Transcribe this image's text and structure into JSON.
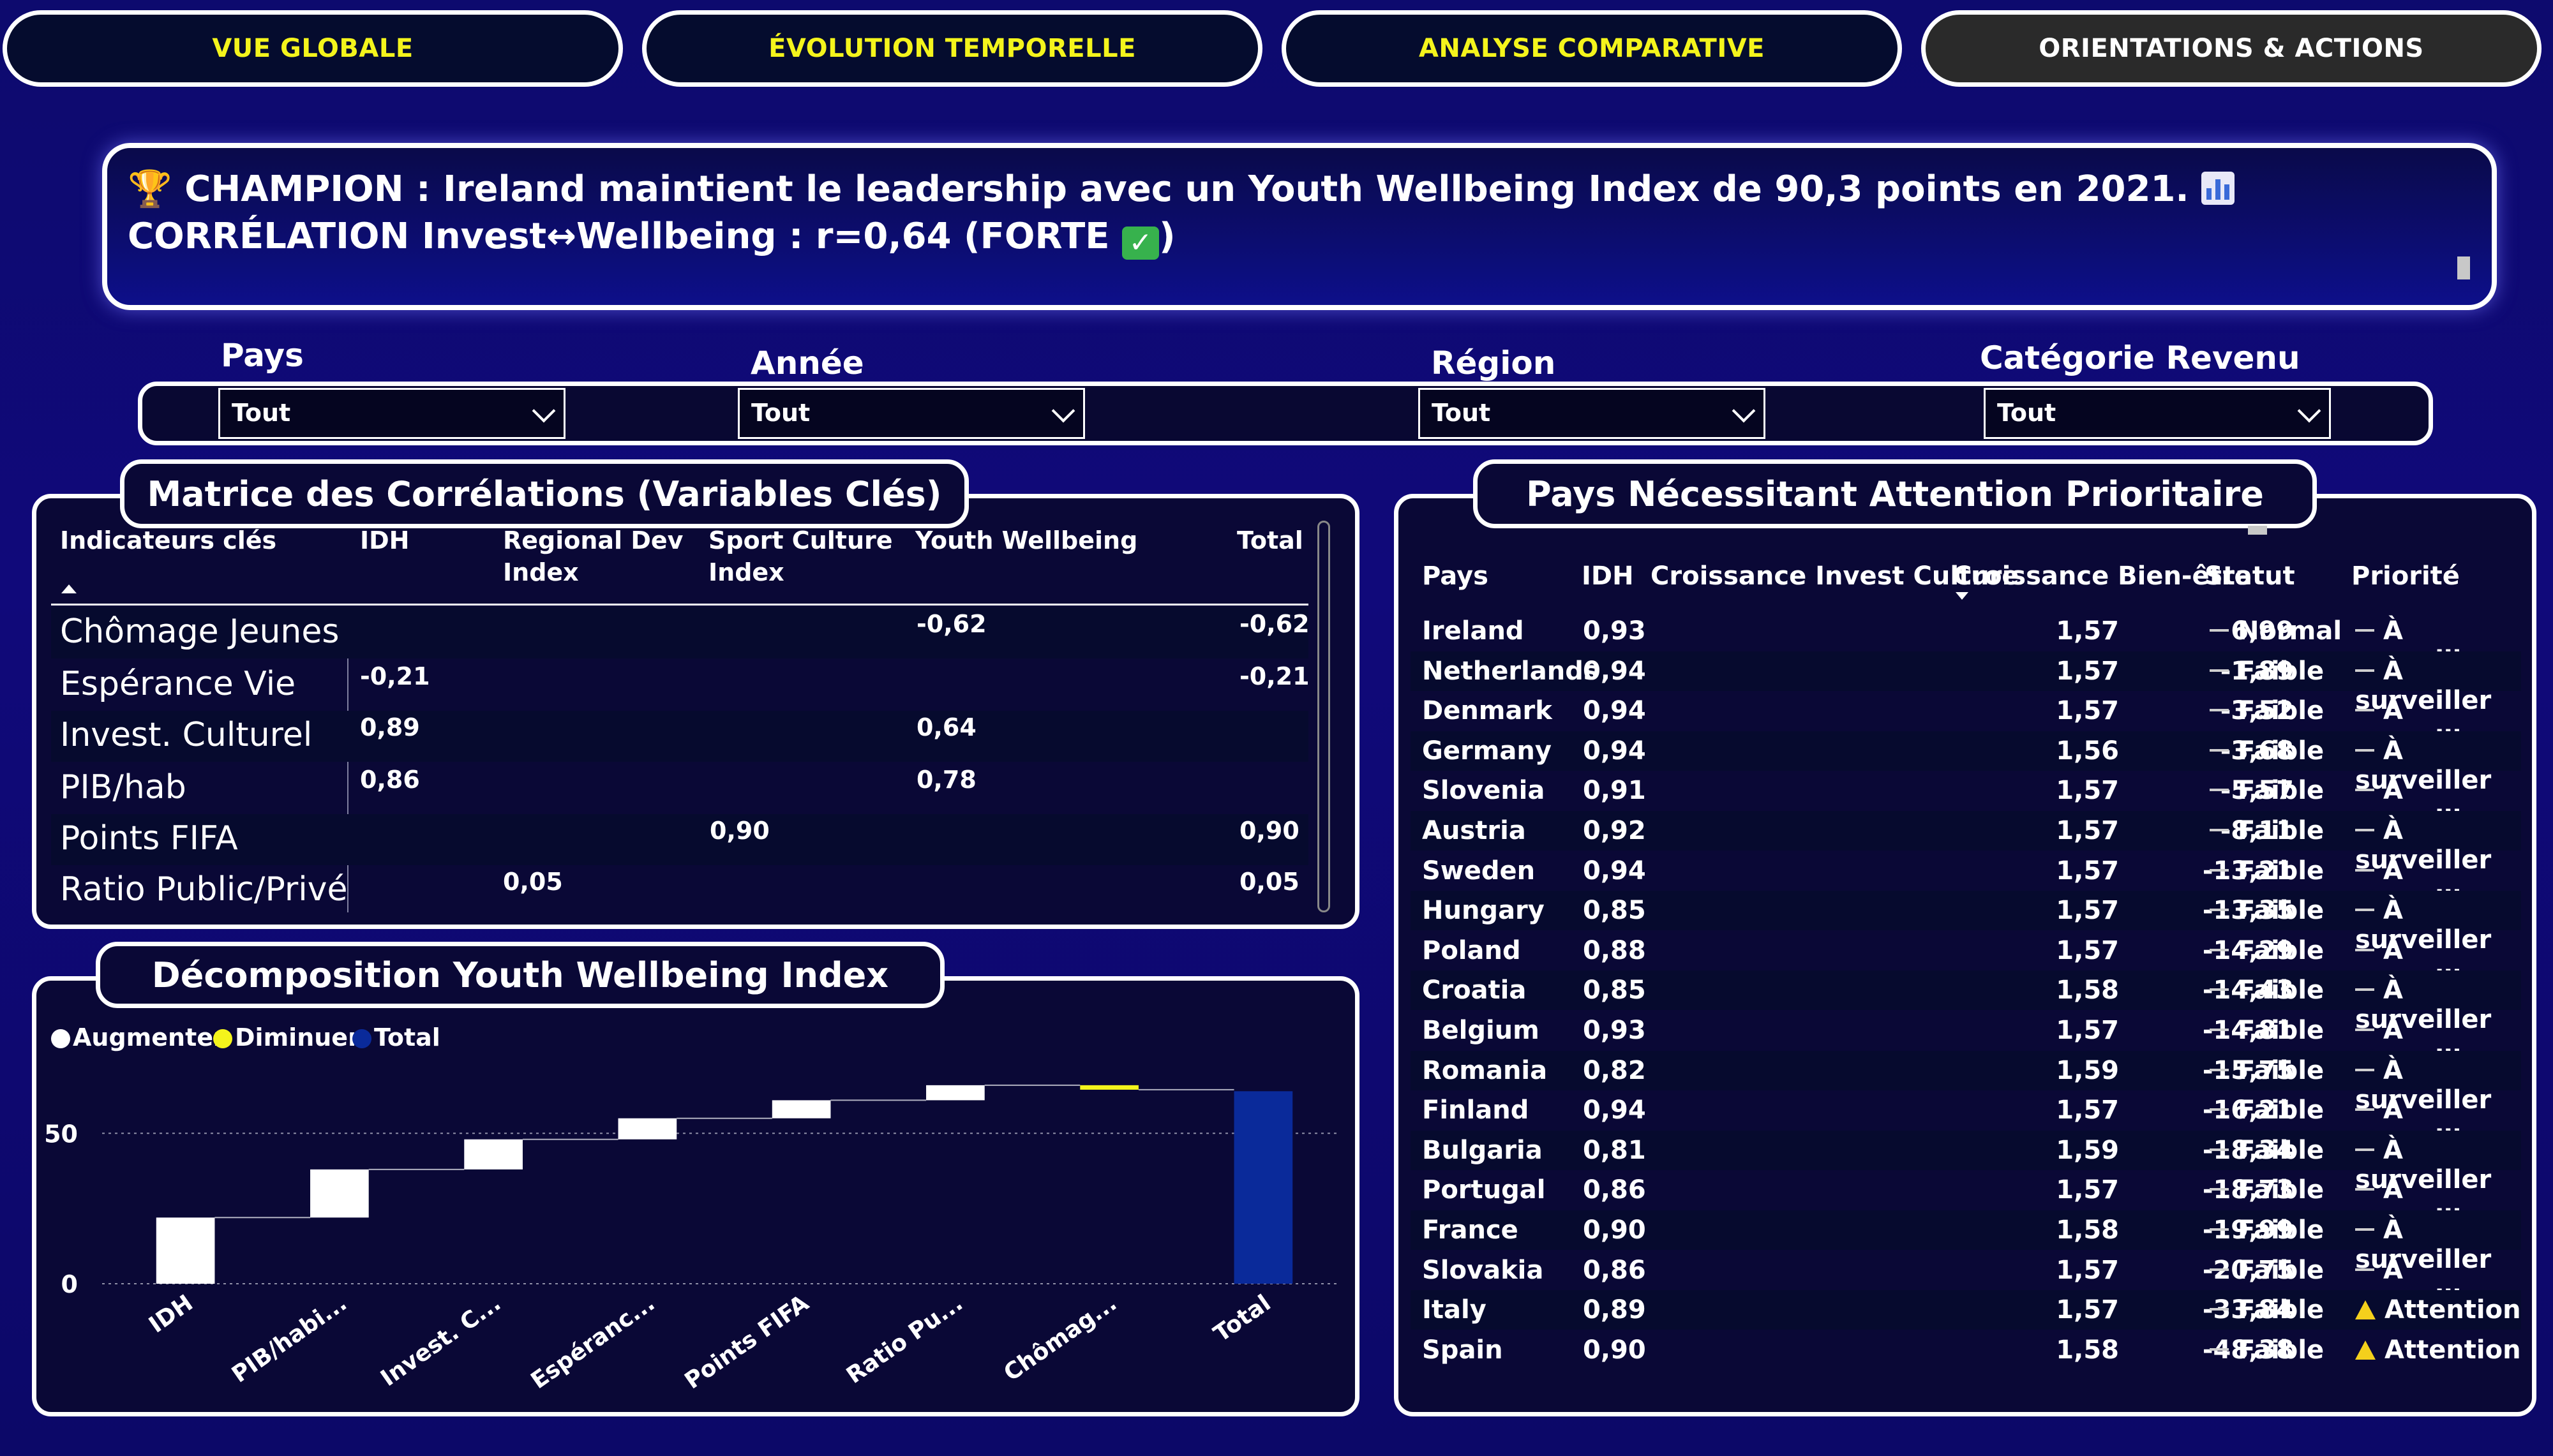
{
  "tabs": [
    {
      "label": "VUE GLOBALE"
    },
    {
      "label": "ÉVOLUTION TEMPORELLE"
    },
    {
      "label": "ANALYSE COMPARATIVE"
    },
    {
      "label": "ORIENTATIONS & ACTIONS"
    }
  ],
  "banner": {
    "part1": " CHAMPION : Ireland maintient le leadership avec un Youth Wellbeing Index de 90,3 points en 2021. ",
    "part2": " CORRÉLATION Invest↔Wellbeing : r=0,64 (FORTE ",
    "check": "✓",
    "part3": ")"
  },
  "filters": [
    {
      "label": "Pays",
      "value": "Tout"
    },
    {
      "label": "Année",
      "value": "Tout"
    },
    {
      "label": "Région",
      "value": "Tout"
    },
    {
      "label": "Catégorie Revenu",
      "value": "Tout"
    }
  ],
  "correlation": {
    "title": "Matrice des Corrélations (Variables Clés)",
    "headers": [
      "Indicateurs clés",
      "IDH",
      "Regional Dev Index",
      "Sport Culture Index",
      "Youth Wellbeing",
      "Total"
    ],
    "rows": [
      {
        "label": "Chômage Jeunes",
        "idh": "",
        "regional": "",
        "sport": "",
        "youth": "-0,62",
        "total": "-0,62"
      },
      {
        "label": "Espérance Vie",
        "idh": "-0,21",
        "regional": "",
        "sport": "",
        "youth": "",
        "total": "-0,21"
      },
      {
        "label": "Invest. Culturel",
        "idh": "0,89",
        "regional": "",
        "sport": "",
        "youth": "0,64",
        "total": ""
      },
      {
        "label": "PIB/hab",
        "idh": "0,86",
        "regional": "",
        "sport": "",
        "youth": "0,78",
        "total": ""
      },
      {
        "label": "Points FIFA",
        "idh": "",
        "regional": "",
        "sport": "0,90",
        "youth": "",
        "total": "0,90"
      },
      {
        "label": "Ratio Public/Privé",
        "idh": "",
        "regional": "0,05",
        "sport": "",
        "youth": "",
        "total": "0,05"
      }
    ]
  },
  "waterfall": {
    "title": "Décomposition Youth Wellbeing Index",
    "legend": [
      {
        "label": "Augmenter",
        "color": "#ffffff"
      },
      {
        "label": "Diminuer",
        "color": "#f4f41c"
      },
      {
        "label": "Total",
        "color": "#0a2a9a"
      }
    ]
  },
  "chart_data": {
    "type": "bar",
    "subtype": "waterfall",
    "title": "Décomposition Youth Wellbeing Index",
    "categories": [
      "IDH",
      "PIB/habi...",
      "Invest. C...",
      "Espéranc...",
      "Points FIFA",
      "Ratio Pu...",
      "Chômag...",
      "Total"
    ],
    "values": [
      22,
      16,
      10,
      7,
      6,
      5,
      -1.5,
      64
    ],
    "kinds": [
      "increase",
      "increase",
      "increase",
      "increase",
      "increase",
      "increase",
      "decrease",
      "total"
    ],
    "yticks": [
      0,
      50
    ],
    "ylim": [
      0,
      70
    ],
    "grid": true,
    "legend_position": "top-left"
  },
  "priority": {
    "title": "Pays Nécessitant Attention Prioritaire",
    "headers": [
      "Pays",
      "IDH",
      "Croissance Invest Culture",
      "Croissance Bien-être",
      "Statut",
      "Priorité"
    ],
    "rows": [
      {
        "pays": "Ireland",
        "idh": "0,93",
        "invest": "1,57",
        "bien": "6,99",
        "statut": "Normal",
        "priorite": "À surveiller",
        "alert": false
      },
      {
        "pays": "Netherlands",
        "idh": "0,94",
        "invest": "1,57",
        "bien": "-1,89",
        "statut": "Faible",
        "priorite": "À surveiller",
        "alert": false
      },
      {
        "pays": "Denmark",
        "idh": "0,94",
        "invest": "1,57",
        "bien": "-3,52",
        "statut": "Faible",
        "priorite": "À surveiller",
        "alert": false
      },
      {
        "pays": "Germany",
        "idh": "0,94",
        "invest": "1,56",
        "bien": "-3,68",
        "statut": "Faible",
        "priorite": "À surveiller",
        "alert": false
      },
      {
        "pays": "Slovenia",
        "idh": "0,91",
        "invest": "1,57",
        "bien": "-5,57",
        "statut": "Faible",
        "priorite": "À surveiller",
        "alert": false
      },
      {
        "pays": "Austria",
        "idh": "0,92",
        "invest": "1,57",
        "bien": "-8,11",
        "statut": "Faible",
        "priorite": "À surveiller",
        "alert": false
      },
      {
        "pays": "Sweden",
        "idh": "0,94",
        "invest": "1,57",
        "bien": "-13,21",
        "statut": "Faible",
        "priorite": "À surveiller",
        "alert": false
      },
      {
        "pays": "Hungary",
        "idh": "0,85",
        "invest": "1,57",
        "bien": "-13,35",
        "statut": "Faible",
        "priorite": "À surveiller",
        "alert": false
      },
      {
        "pays": "Poland",
        "idh": "0,88",
        "invest": "1,57",
        "bien": "-14,29",
        "statut": "Faible",
        "priorite": "À surveiller",
        "alert": false
      },
      {
        "pays": "Croatia",
        "idh": "0,85",
        "invest": "1,58",
        "bien": "-14,43",
        "statut": "Faible",
        "priorite": "À surveiller",
        "alert": false
      },
      {
        "pays": "Belgium",
        "idh": "0,93",
        "invest": "1,57",
        "bien": "-14,81",
        "statut": "Faible",
        "priorite": "À surveiller",
        "alert": false
      },
      {
        "pays": "Romania",
        "idh": "0,82",
        "invest": "1,59",
        "bien": "-15,75",
        "statut": "Faible",
        "priorite": "À surveiller",
        "alert": false
      },
      {
        "pays": "Finland",
        "idh": "0,94",
        "invest": "1,57",
        "bien": "-16,21",
        "statut": "Faible",
        "priorite": "À surveiller",
        "alert": false
      },
      {
        "pays": "Bulgaria",
        "idh": "0,81",
        "invest": "1,59",
        "bien": "-18,34",
        "statut": "Faible",
        "priorite": "À surveiller",
        "alert": false
      },
      {
        "pays": "Portugal",
        "idh": "0,86",
        "invest": "1,57",
        "bien": "-18,73",
        "statut": "Faible",
        "priorite": "À surveiller",
        "alert": false
      },
      {
        "pays": "France",
        "idh": "0,90",
        "invest": "1,58",
        "bien": "-19,99",
        "statut": "Faible",
        "priorite": "À surveiller",
        "alert": false
      },
      {
        "pays": "Slovakia",
        "idh": "0,86",
        "invest": "1,57",
        "bien": "-20,75",
        "statut": "Faible",
        "priorite": "À surveiller",
        "alert": false
      },
      {
        "pays": "Italy",
        "idh": "0,89",
        "invest": "1,57",
        "bien": "-33,84",
        "statut": "Faible",
        "priorite": "Attention",
        "alert": true
      },
      {
        "pays": "Spain",
        "idh": "0,90",
        "invest": "1,58",
        "bien": "-48,38",
        "statut": "Faible",
        "priorite": "Attention",
        "alert": true
      }
    ]
  }
}
